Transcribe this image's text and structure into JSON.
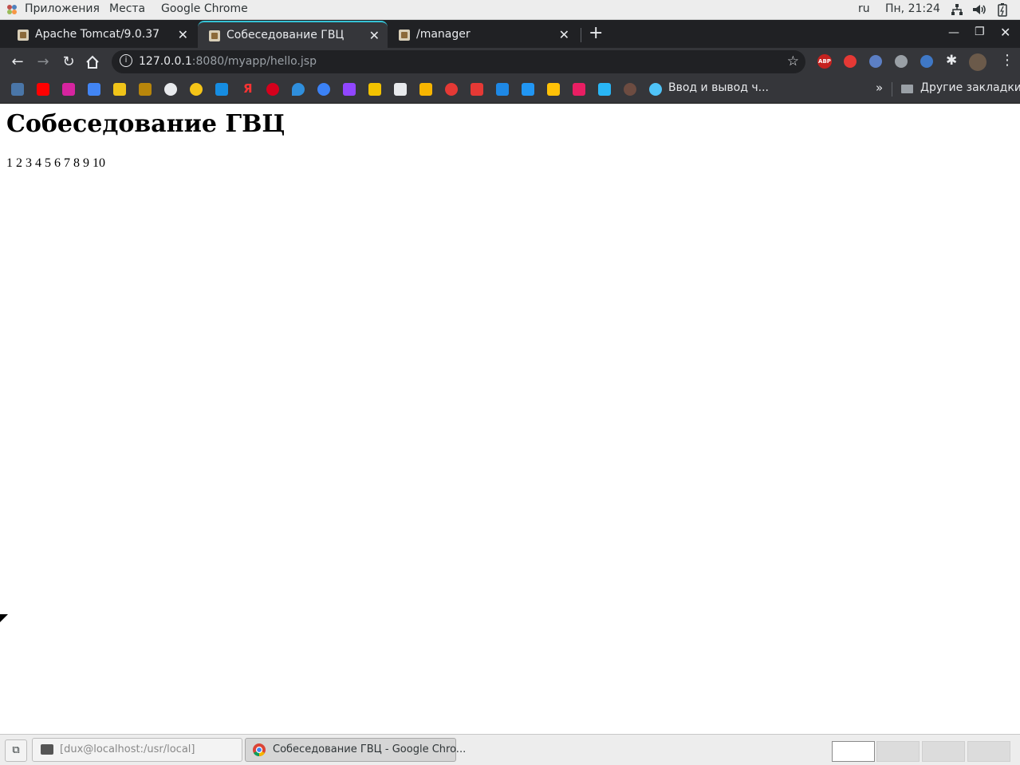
{
  "topbar": {
    "applications": "Приложения",
    "places": "Места",
    "app_name": "Google Chrome",
    "keyboard_layout": "ru",
    "datetime": "Пн, 21:24"
  },
  "browser": {
    "tabs": [
      {
        "title": "Apache Tomcat/9.0.37",
        "active": false
      },
      {
        "title": "Собеседование ГВЦ",
        "active": true
      },
      {
        "title": "/manager",
        "active": false
      }
    ],
    "url_host": "127.0.0.1",
    "url_rest": ":8080/myapp/hello.jsp",
    "bookmark_folder_item": "Ввод и вывод ч...",
    "other_bookmarks": "Другие закладки",
    "extension_abp": "ABP"
  },
  "page": {
    "heading": "Собеседование ГВЦ",
    "numbers": "1 2 3 4 5 6 7 8 9 10"
  },
  "taskbar": {
    "terminal": "[dux@localhost:/usr/local]",
    "chrome": "Собеседование ГВЦ - Google Chro..."
  },
  "colors": {
    "accent_tab": "#35c3d6",
    "chrome_dark": "#202124",
    "chrome_toolbar": "#35363a"
  }
}
